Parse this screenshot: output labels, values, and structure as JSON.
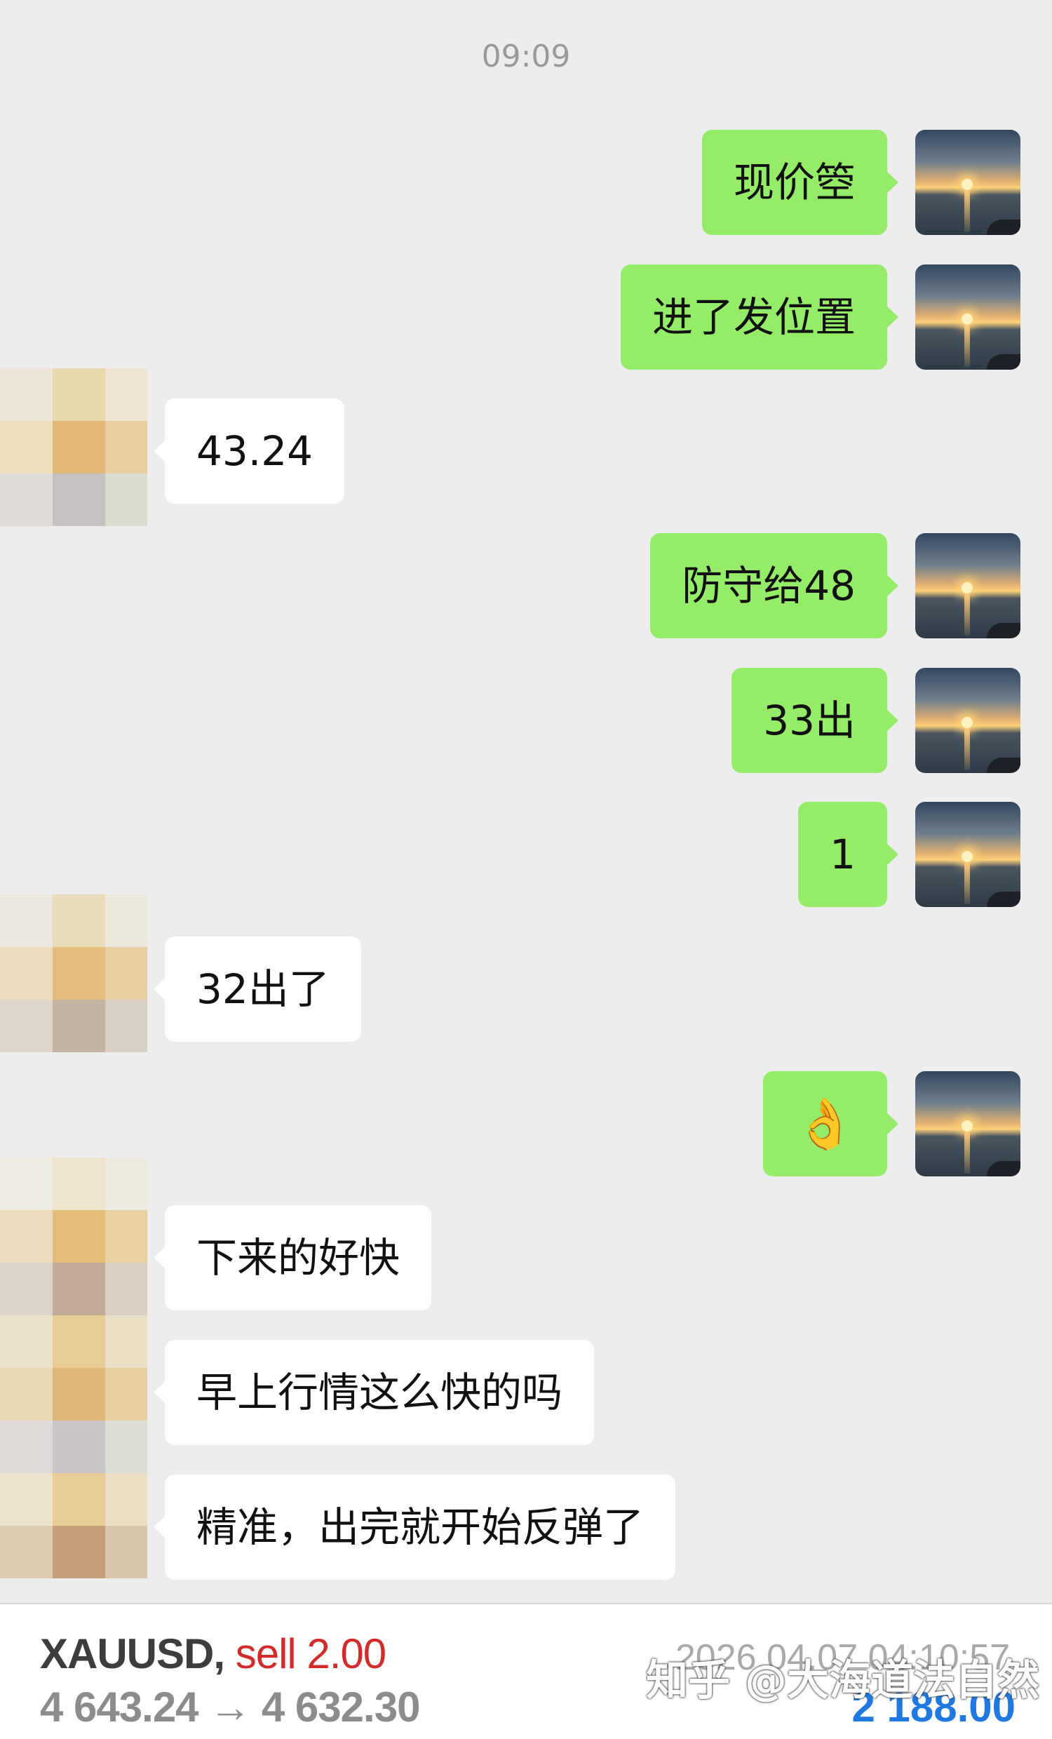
{
  "chat": {
    "timestamp": "09:09",
    "messages": [
      {
        "from": "self",
        "text": "现价箜"
      },
      {
        "from": "self",
        "text": "进了发位置"
      },
      {
        "from": "other",
        "text": "43.24"
      },
      {
        "from": "self",
        "text": "防守给48"
      },
      {
        "from": "self",
        "text": "33出"
      },
      {
        "from": "self",
        "text": "1"
      },
      {
        "from": "other",
        "text": "32出了"
      },
      {
        "from": "self",
        "text": "👌"
      },
      {
        "from": "other",
        "text": "下来的好快"
      },
      {
        "from": "other",
        "text": "早上行情这么快的吗"
      },
      {
        "from": "other",
        "text": "精准，出完就开始反弹了"
      }
    ]
  },
  "trade": {
    "symbol": "XAUUSD,",
    "direction": "sell 2.00",
    "prices": "4 643.24 → 4 632.30",
    "datetime": "2026.04.07 04:10:57",
    "profit": "2 188.00"
  },
  "watermark": "知乎 @大海道法自然",
  "colors": {
    "background": "#ededed",
    "self_bubble": "#95ec69",
    "other_bubble": "#ffffff",
    "sell_red": "#d32b2b",
    "profit_blue": "#1f79e0"
  }
}
